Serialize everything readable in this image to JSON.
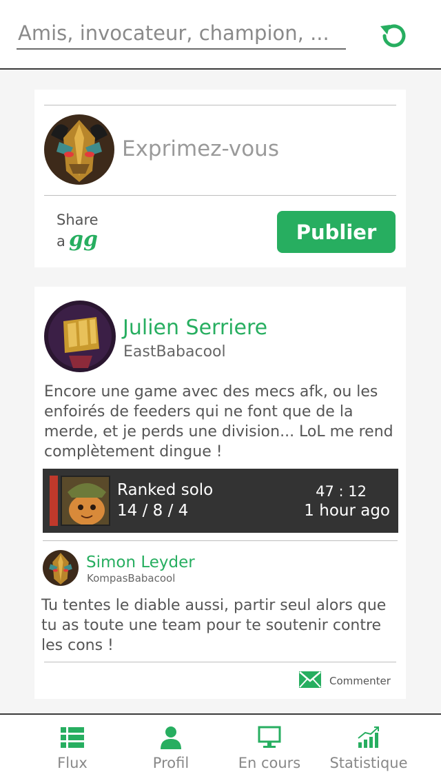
{
  "search": {
    "placeholder": "Amis, invocateur, champion, ..."
  },
  "colors": {
    "accent": "#27ae60",
    "game_bg": "#333333",
    "loss_stripe": "#c0392b"
  },
  "composer": {
    "prompt": "Exprimez-vous",
    "share_line1": "Share",
    "share_line2": "a",
    "share_logo": "gg",
    "publish_label": "Publier"
  },
  "post": {
    "author": "Julien Serriere",
    "handle": "EastBabacool",
    "text": "Encore une game avec des mecs afk, ou les enfoirés de feeders qui ne font que de la merde, et je perds une division... LoL me rend complètement dingue !",
    "game": {
      "mode": "Ranked solo",
      "kda": "14 / 8 / 4",
      "duration": "47 : 12",
      "time_ago": "1 hour ago"
    },
    "comment": {
      "author": "Simon Leyder",
      "handle": "KompasBabacool",
      "text": "Tu tentes le diable aussi, partir seul alors que tu as toute une team pour te soutenir contre les cons !"
    },
    "comment_action": "Commenter"
  },
  "tabs": [
    {
      "label": "Flux",
      "icon": "list-icon"
    },
    {
      "label": "Profil",
      "icon": "user-icon"
    },
    {
      "label": "En cours",
      "icon": "monitor-icon"
    },
    {
      "label": "Statistique",
      "icon": "chart-icon"
    }
  ]
}
